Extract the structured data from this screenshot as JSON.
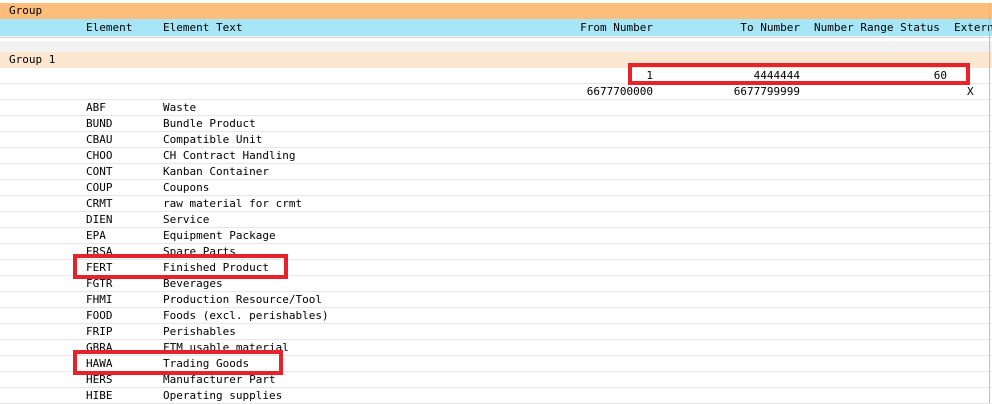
{
  "group_bar": {
    "title": "Group"
  },
  "header": {
    "element": "Element",
    "element_text": "Element Text",
    "from_number": "From Number",
    "to_number": "To Number",
    "nr_status": "Number Range Status",
    "external": "Extern"
  },
  "group1": {
    "label": "Group 1"
  },
  "ranges": [
    {
      "from": "1",
      "to": "4444444",
      "status": "60",
      "external": ""
    },
    {
      "from": "6677700000",
      "to": "6677799999",
      "status": "",
      "external": "X"
    }
  ],
  "rows": [
    {
      "code": "ABF",
      "text": "Waste"
    },
    {
      "code": "BUND",
      "text": "Bundle Product"
    },
    {
      "code": "CBAU",
      "text": "Compatible Unit"
    },
    {
      "code": "CHOO",
      "text": "CH Contract Handling"
    },
    {
      "code": "CONT",
      "text": "Kanban Container"
    },
    {
      "code": "COUP",
      "text": "Coupons"
    },
    {
      "code": "CRMT",
      "text": "raw material for crmt"
    },
    {
      "code": "DIEN",
      "text": "Service"
    },
    {
      "code": "EPA",
      "text": "Equipment Package"
    },
    {
      "code": "ERSA",
      "text": "Spare Parts"
    },
    {
      "code": "FERT",
      "text": "Finished Product"
    },
    {
      "code": "FGTR",
      "text": "Beverages"
    },
    {
      "code": "FHMI",
      "text": "Production Resource/Tool"
    },
    {
      "code": "FOOD",
      "text": "Foods (excl. perishables)"
    },
    {
      "code": "FRIP",
      "text": "Perishables"
    },
    {
      "code": "GBRA",
      "text": "FTM usable material"
    },
    {
      "code": "HAWA",
      "text": "Trading Goods"
    },
    {
      "code": "HERS",
      "text": "Manufacturer Part"
    },
    {
      "code": "HIBE",
      "text": "Operating supplies"
    }
  ],
  "colors": {
    "group_bar": "#fdbe7c",
    "header_bar": "#a6e6f6",
    "group1_bar": "#fde6cf",
    "highlight": "#e8222a"
  }
}
